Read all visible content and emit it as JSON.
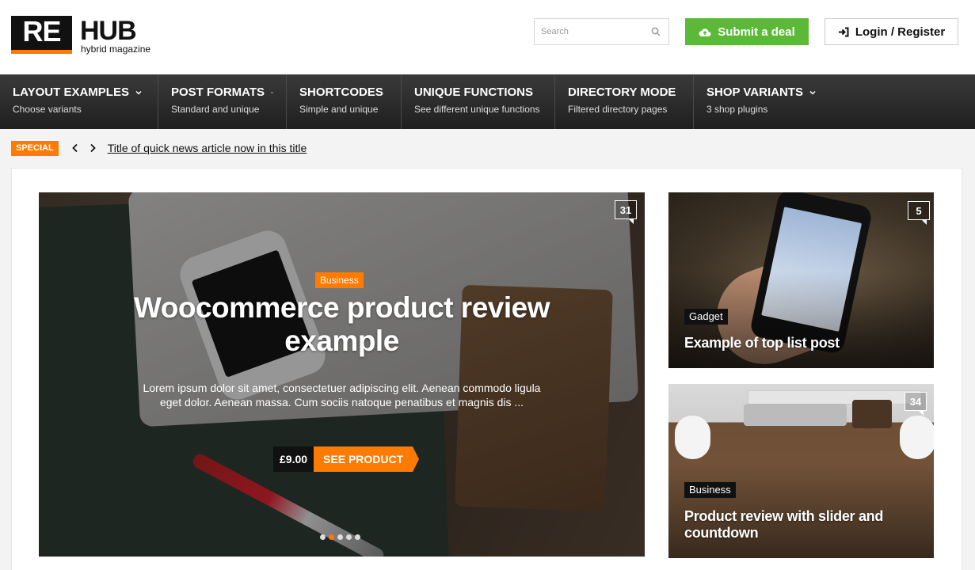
{
  "header": {
    "logo_re": "RE",
    "logo_hub": "HUB",
    "logo_tagline": "hybrid magazine",
    "search_placeholder": "Search",
    "submit_label": "Submit a deal",
    "login_label": "Login / Register"
  },
  "nav": [
    {
      "title": "LAYOUT EXAMPLES",
      "sub": "Choose variants"
    },
    {
      "title": "POST FORMATS",
      "sub": "Standard and unique"
    },
    {
      "title": "SHORTCODES",
      "sub": "Simple and unique"
    },
    {
      "title": "UNIQUE FUNCTIONS",
      "sub": "See different unique functions"
    },
    {
      "title": "DIRECTORY MODE",
      "sub": "Filtered directory pages"
    },
    {
      "title": "SHOP VARIANTS",
      "sub": "3 shop plugins"
    }
  ],
  "ticker": {
    "label": "SPECIAL",
    "headline": "Title of quick news article now in this title"
  },
  "hero": {
    "comments": "31",
    "category": "Business",
    "title": "Woocommerce product review example",
    "excerpt": "Lorem ipsum dolor sit amet, consectetuer adipiscing elit. Aenean commodo ligula eget dolor. Aenean massa. Cum sociis natoque penatibus et magnis dis ...",
    "price": "£9.00",
    "cta": "SEE PRODUCT",
    "slides": 5,
    "active_slide": 2
  },
  "cards": [
    {
      "comments": "5",
      "category": "Gadget",
      "title": "Example of top list post"
    },
    {
      "comments": "34",
      "category": "Business",
      "title": "Product review with slider and countdown"
    }
  ],
  "colors": {
    "accent": "#fe7b00",
    "green": "#5bb937",
    "nav_bg": "#2b2b2b"
  }
}
